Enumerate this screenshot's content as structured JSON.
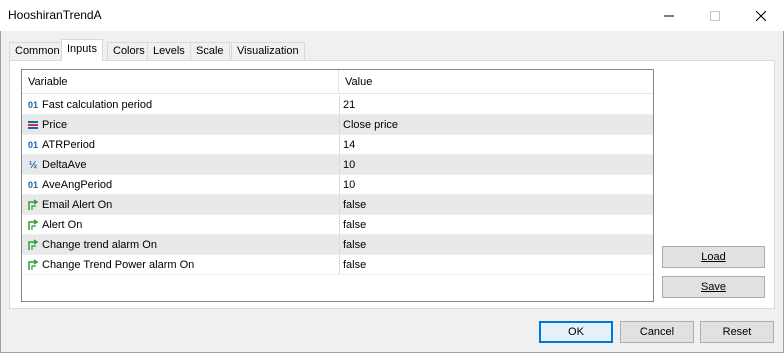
{
  "window": {
    "title": "HooshiranTrendA",
    "minimize_icon": "minimize-icon",
    "maximize_icon": "maximize-icon",
    "close_icon": "close-icon"
  },
  "tabs": [
    {
      "label": "Common",
      "active": false
    },
    {
      "label": "Inputs",
      "active": true
    },
    {
      "label": "Colors",
      "active": false
    },
    {
      "label": "Levels",
      "active": false
    },
    {
      "label": "Scale",
      "active": false
    },
    {
      "label": "Visualization",
      "active": false
    }
  ],
  "grid": {
    "headers": {
      "variable": "Variable",
      "value": "Value"
    },
    "rows": [
      {
        "icon": "integer-icon",
        "name": "Fast calculation period",
        "value": "21"
      },
      {
        "icon": "enum-icon",
        "name": "Price",
        "value": "Close price"
      },
      {
        "icon": "integer-icon",
        "name": "ATRPeriod",
        "value": "14"
      },
      {
        "icon": "double-icon",
        "name": "DeltaAve",
        "value": "10"
      },
      {
        "icon": "integer-icon",
        "name": "AveAngPeriod",
        "value": "10"
      },
      {
        "icon": "bool-icon",
        "name": "Email Alert On",
        "value": "false"
      },
      {
        "icon": "bool-icon",
        "name": "Alert On",
        "value": "false"
      },
      {
        "icon": "bool-icon",
        "name": "Change trend alarm On",
        "value": "false"
      },
      {
        "icon": "bool-icon",
        "name": "Change Trend Power alarm On",
        "value": "false"
      }
    ]
  },
  "side_buttons": {
    "load": "Load",
    "save": "Save"
  },
  "footer_buttons": {
    "ok": "OK",
    "cancel": "Cancel",
    "reset": "Reset"
  },
  "colors": {
    "accent": "#0078d7",
    "row_shade": "#e8e8e8",
    "bool_icon": "#2e9e3a",
    "int_icon": "#1a5fb4"
  }
}
